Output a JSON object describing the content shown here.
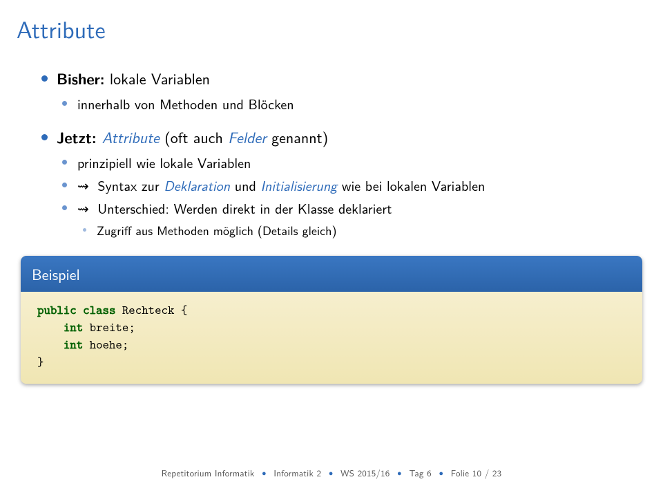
{
  "title": "Attribute",
  "bullets": {
    "bisher_bold": "Bisher:",
    "bisher_rest": " lokale Variablen",
    "bisher_sub1": "innerhalb von Methoden und Blöcken",
    "jetzt_bold": "Jetzt: ",
    "jetzt_attr": "Attribute",
    "jetzt_rest1": " (oft auch ",
    "jetzt_felder": "Felder",
    "jetzt_rest2": " genannt)",
    "sub_prinz": "prinzipiell wie lokale Variablen",
    "arrow": "⇝",
    "sub_syntax1": " Syntax zur ",
    "sub_syntax_em1": "Deklaration",
    "sub_syntax2": " und ",
    "sub_syntax_em2": "Initialisierung",
    "sub_syntax3": " wie bei lokalen Variablen",
    "sub_unt": " Unterschied: Werden direkt in der Klasse deklariert",
    "sub_zugriff": "Zugriff aus Methoden möglich (Details gleich)"
  },
  "example": {
    "header": "Beispiel",
    "kw_public": "public",
    "kw_class": "class",
    "classname": " Rechteck {",
    "kw_int1": "int",
    "line_b": " breite;",
    "kw_int2": "int",
    "line_h": " hoehe;",
    "close": "}"
  },
  "footer": {
    "a": "Repetitorium Informatik",
    "b": "Informatik 2",
    "c": "WS 2015/16",
    "d": "Tag 6",
    "e": "Folie 10 / 23"
  }
}
